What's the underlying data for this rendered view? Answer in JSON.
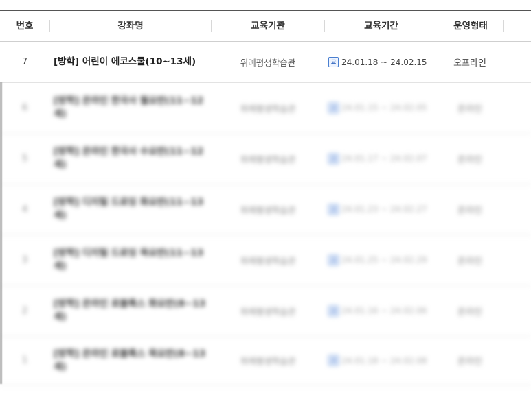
{
  "columns": {
    "num": "번호",
    "title": "강좌명",
    "institution": "교육기관",
    "period": "교육기간",
    "type": "운영형태"
  },
  "calendar_icon_glyph": "교",
  "rows": [
    {
      "num": "7",
      "title": "[방학] 어린이 에코스쿨(10~13세)",
      "institution": "위례평생학습관",
      "period": "24.01.18 ~ 24.02.15",
      "type": "오프라인",
      "blurred": false
    },
    {
      "num": "6",
      "title": "[방학] 온라인 한국사 월요반(11~12세)",
      "institution": "위례평생학습관",
      "period": "24.01.15 ~ 24.02.05",
      "type": "온라인",
      "blurred": true
    },
    {
      "num": "5",
      "title": "[방학] 온라인 한국사 수요반(11~12세)",
      "institution": "위례평생학습관",
      "period": "24.01.17 ~ 24.02.07",
      "type": "온라인",
      "blurred": true
    },
    {
      "num": "4",
      "title": "[방학] 디지털 드로잉 화요반(11~13세)",
      "institution": "위례평생학습관",
      "period": "24.01.23 ~ 24.02.27",
      "type": "온라인",
      "blurred": true
    },
    {
      "num": "3",
      "title": "[방학] 디지털 드로잉 목요반(11~13세)",
      "institution": "위례평생학습관",
      "period": "24.01.25 ~ 24.02.29",
      "type": "온라인",
      "blurred": true
    },
    {
      "num": "2",
      "title": "[방학] 온라인 로블록스 화요반(8~13세)",
      "institution": "위례평생학습관",
      "period": "24.01.16 ~ 24.02.06",
      "type": "온라인",
      "blurred": true
    },
    {
      "num": "1",
      "title": "[방학] 온라인 로블록스 목요반(8~13세)",
      "institution": "위례평생학습관",
      "period": "24.01.18 ~ 24.02.08",
      "type": "온라인",
      "blurred": true
    }
  ]
}
